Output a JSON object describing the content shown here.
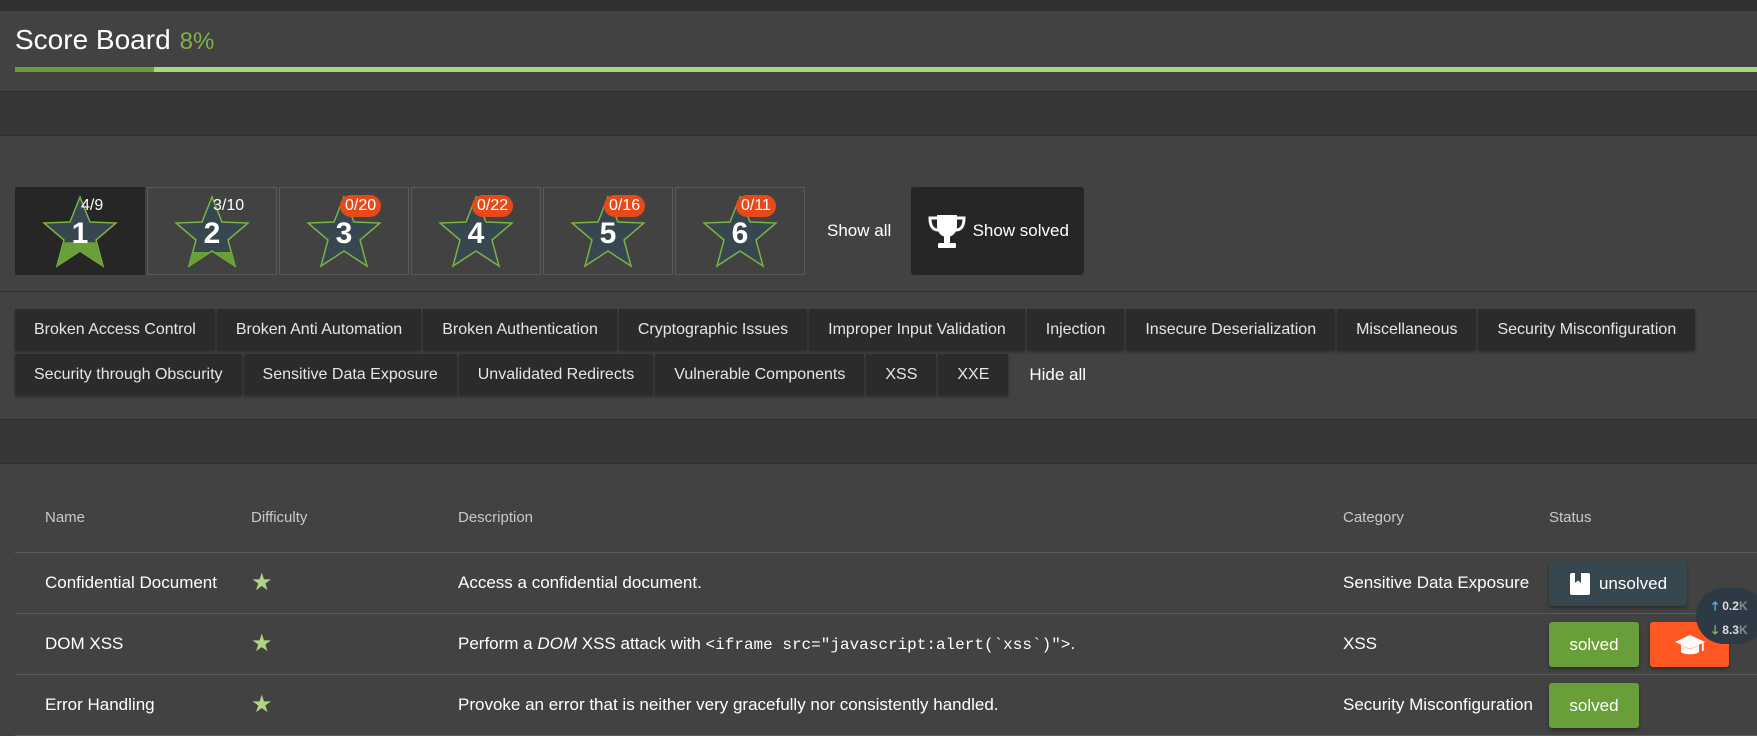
{
  "header": {
    "title": "Score Board",
    "percent_label": "8%",
    "progress": 0.08
  },
  "difficulty": {
    "items": [
      {
        "level": "1",
        "count": "4/9",
        "active": true,
        "fraction": 0.44
      },
      {
        "level": "2",
        "count": "3/10",
        "active": false,
        "fraction": 0.3
      },
      {
        "level": "3",
        "count": "0/20",
        "active": false,
        "fraction": 0
      },
      {
        "level": "4",
        "count": "0/22",
        "active": false,
        "fraction": 0
      },
      {
        "level": "5",
        "count": "0/16",
        "active": false,
        "fraction": 0
      },
      {
        "level": "6",
        "count": "0/11",
        "active": false,
        "fraction": 0
      }
    ],
    "show_all_label": "Show all",
    "show_solved_label": "Show solved",
    "show_solved_icon": "trophy-icon"
  },
  "categories": {
    "row1": [
      "Broken Access Control",
      "Broken Anti Automation",
      "Broken Authentication",
      "Cryptographic Issues",
      "Improper Input Validation",
      "Injection",
      "Insecure Deserialization",
      "Miscellaneous",
      "Security Misconfiguration"
    ],
    "row2": [
      "Security through Obscurity",
      "Sensitive Data Exposure",
      "Unvalidated Redirects",
      "Vulnerable Components",
      "XSS",
      "XXE"
    ],
    "hide_all_label": "Hide all"
  },
  "table": {
    "headers": {
      "name": "Name",
      "difficulty": "Difficulty",
      "description": "Description",
      "category": "Category",
      "status": "Status"
    },
    "rows": [
      {
        "name": "Confidential Document",
        "difficulty_stars": 1,
        "description": "Access a confidential document.",
        "category": "Sensitive Data Exposure",
        "status": "unsolved",
        "status_icon": "bookmark-icon"
      },
      {
        "name": "DOM XSS",
        "difficulty_stars": 1,
        "description_pre": "Perform a ",
        "description_em": "DOM",
        "description_mid": " XSS attack with ",
        "description_code": "<iframe src=\"javascript:alert(`xss`)\">",
        "description_post": ".",
        "category": "XSS",
        "status": "solved",
        "tutorial_icon": "graduation-cap-icon"
      },
      {
        "name": "Error Handling",
        "difficulty_stars": 1,
        "description": "Provoke an error that is neither very gracefully nor consistently handled.",
        "category": "Security Misconfiguration",
        "status": "solved"
      }
    ]
  },
  "network_widget": {
    "upload": "0.2",
    "download": "8.3",
    "unit": "K"
  },
  "colors": {
    "accent_green": "#689f38",
    "light_green": "#aed581",
    "orange": "#ff5722",
    "slate": "#37474f"
  }
}
